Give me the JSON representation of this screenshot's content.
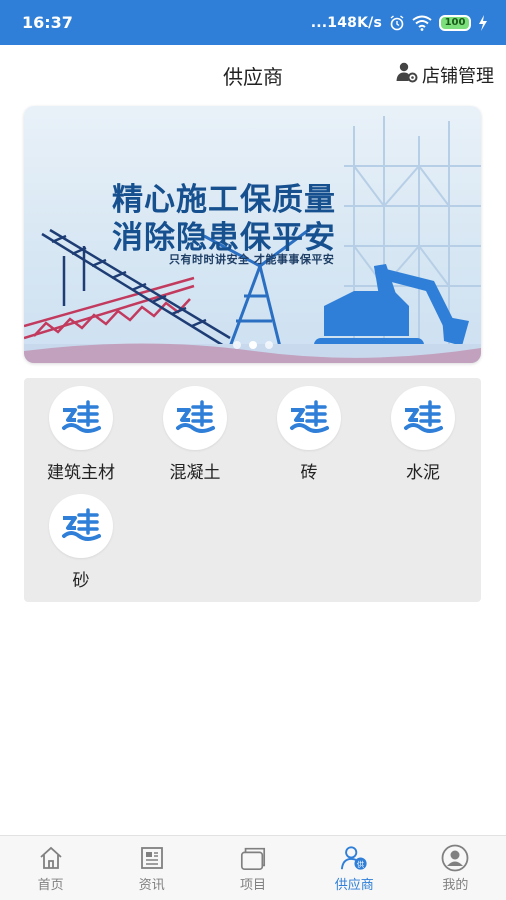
{
  "status_bar": {
    "time": "16:37",
    "network_speed": "...148K/s",
    "battery_level": "100",
    "icons": [
      "alarm-icon",
      "wifi-icon",
      "battery-icon",
      "charging-icon"
    ]
  },
  "header": {
    "title": "供应商",
    "store_manage_label": "店铺管理",
    "store_manage_icon": "user-settings-icon"
  },
  "banner": {
    "line1": "精心施工保质量",
    "line2": "消除隐患保平安",
    "subtitle": "只有时时讲安全  才能事事保平安",
    "dot_count": 3,
    "active_dot": 1
  },
  "categories": [
    {
      "label": "建筑主材",
      "icon": "construction-logo-icon"
    },
    {
      "label": "混凝土",
      "icon": "construction-logo-icon"
    },
    {
      "label": "砖",
      "icon": "construction-logo-icon"
    },
    {
      "label": "水泥",
      "icon": "construction-logo-icon"
    },
    {
      "label": "砂",
      "icon": "construction-logo-icon"
    }
  ],
  "bottom_nav": [
    {
      "label": "首页",
      "icon": "home-icon",
      "active": false
    },
    {
      "label": "资讯",
      "icon": "news-icon",
      "active": false
    },
    {
      "label": "项目",
      "icon": "project-icon",
      "active": false
    },
    {
      "label": "供应商",
      "icon": "supplier-icon",
      "active": true
    },
    {
      "label": "我的",
      "icon": "profile-icon",
      "active": false
    }
  ],
  "colors": {
    "primary": "#2f7fd8",
    "inactive": "#808080",
    "panel": "#ebebeb",
    "banner_text": "#16508f"
  }
}
